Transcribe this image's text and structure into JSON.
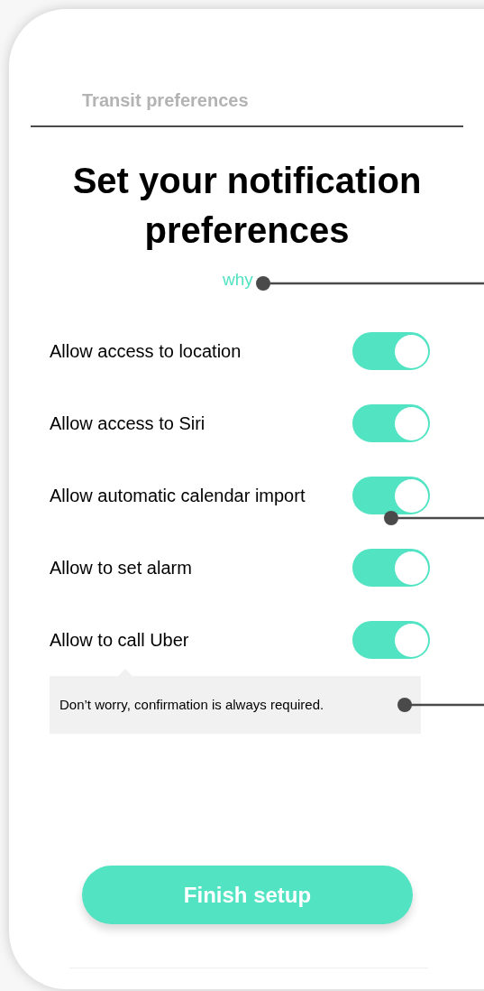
{
  "header": {
    "title": "Transit preferences"
  },
  "heading": "Set your notification preferences",
  "why_link": "why",
  "toggles": [
    {
      "label": "Allow access to location",
      "on": true
    },
    {
      "label": "Allow access to Siri",
      "on": true
    },
    {
      "label": "Allow automatic calendar import",
      "on": true
    },
    {
      "label": "Allow to set alarm",
      "on": true
    },
    {
      "label": "Allow to call Uber",
      "on": true
    }
  ],
  "tooltip": {
    "text": "Don’t worry, confirmation is always required."
  },
  "primary_button": {
    "label": "Finish setup"
  }
}
